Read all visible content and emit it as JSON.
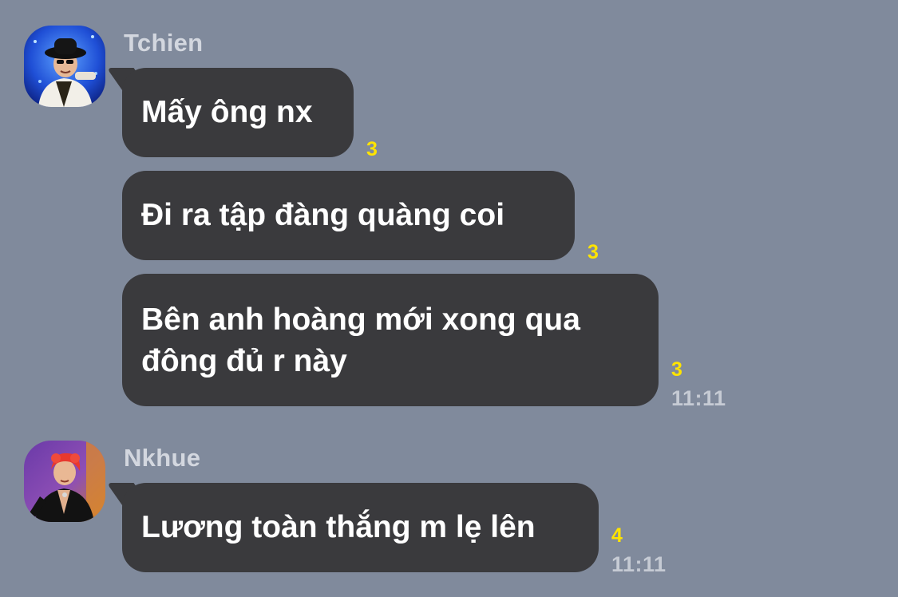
{
  "groups": [
    {
      "sender": "Tchien",
      "messages": [
        {
          "text": "Mấy ông nx",
          "read": "3"
        },
        {
          "text": "Đi ra tập đàng quàng coi",
          "read": "3"
        },
        {
          "text": "Bên anh hoàng mới xong qua đông đủ r này",
          "line1": "Bên anh hoàng mới xong qua",
          "line2": "đông đủ r này",
          "read": "3",
          "time": "11:11"
        }
      ]
    },
    {
      "sender": "Nkhue",
      "messages": [
        {
          "text": "Lương toàn thắng m lẹ lên",
          "read": "4",
          "time": "11:11"
        }
      ]
    }
  ],
  "colors": {
    "background": "#808a9c",
    "bubble": "#3a3a3d",
    "read_count": "#ffe400",
    "sender_name": "#d3d7df"
  },
  "icons": {
    "avatar_1": "profile-photo-tchien",
    "avatar_2": "profile-photo-nkhue"
  }
}
